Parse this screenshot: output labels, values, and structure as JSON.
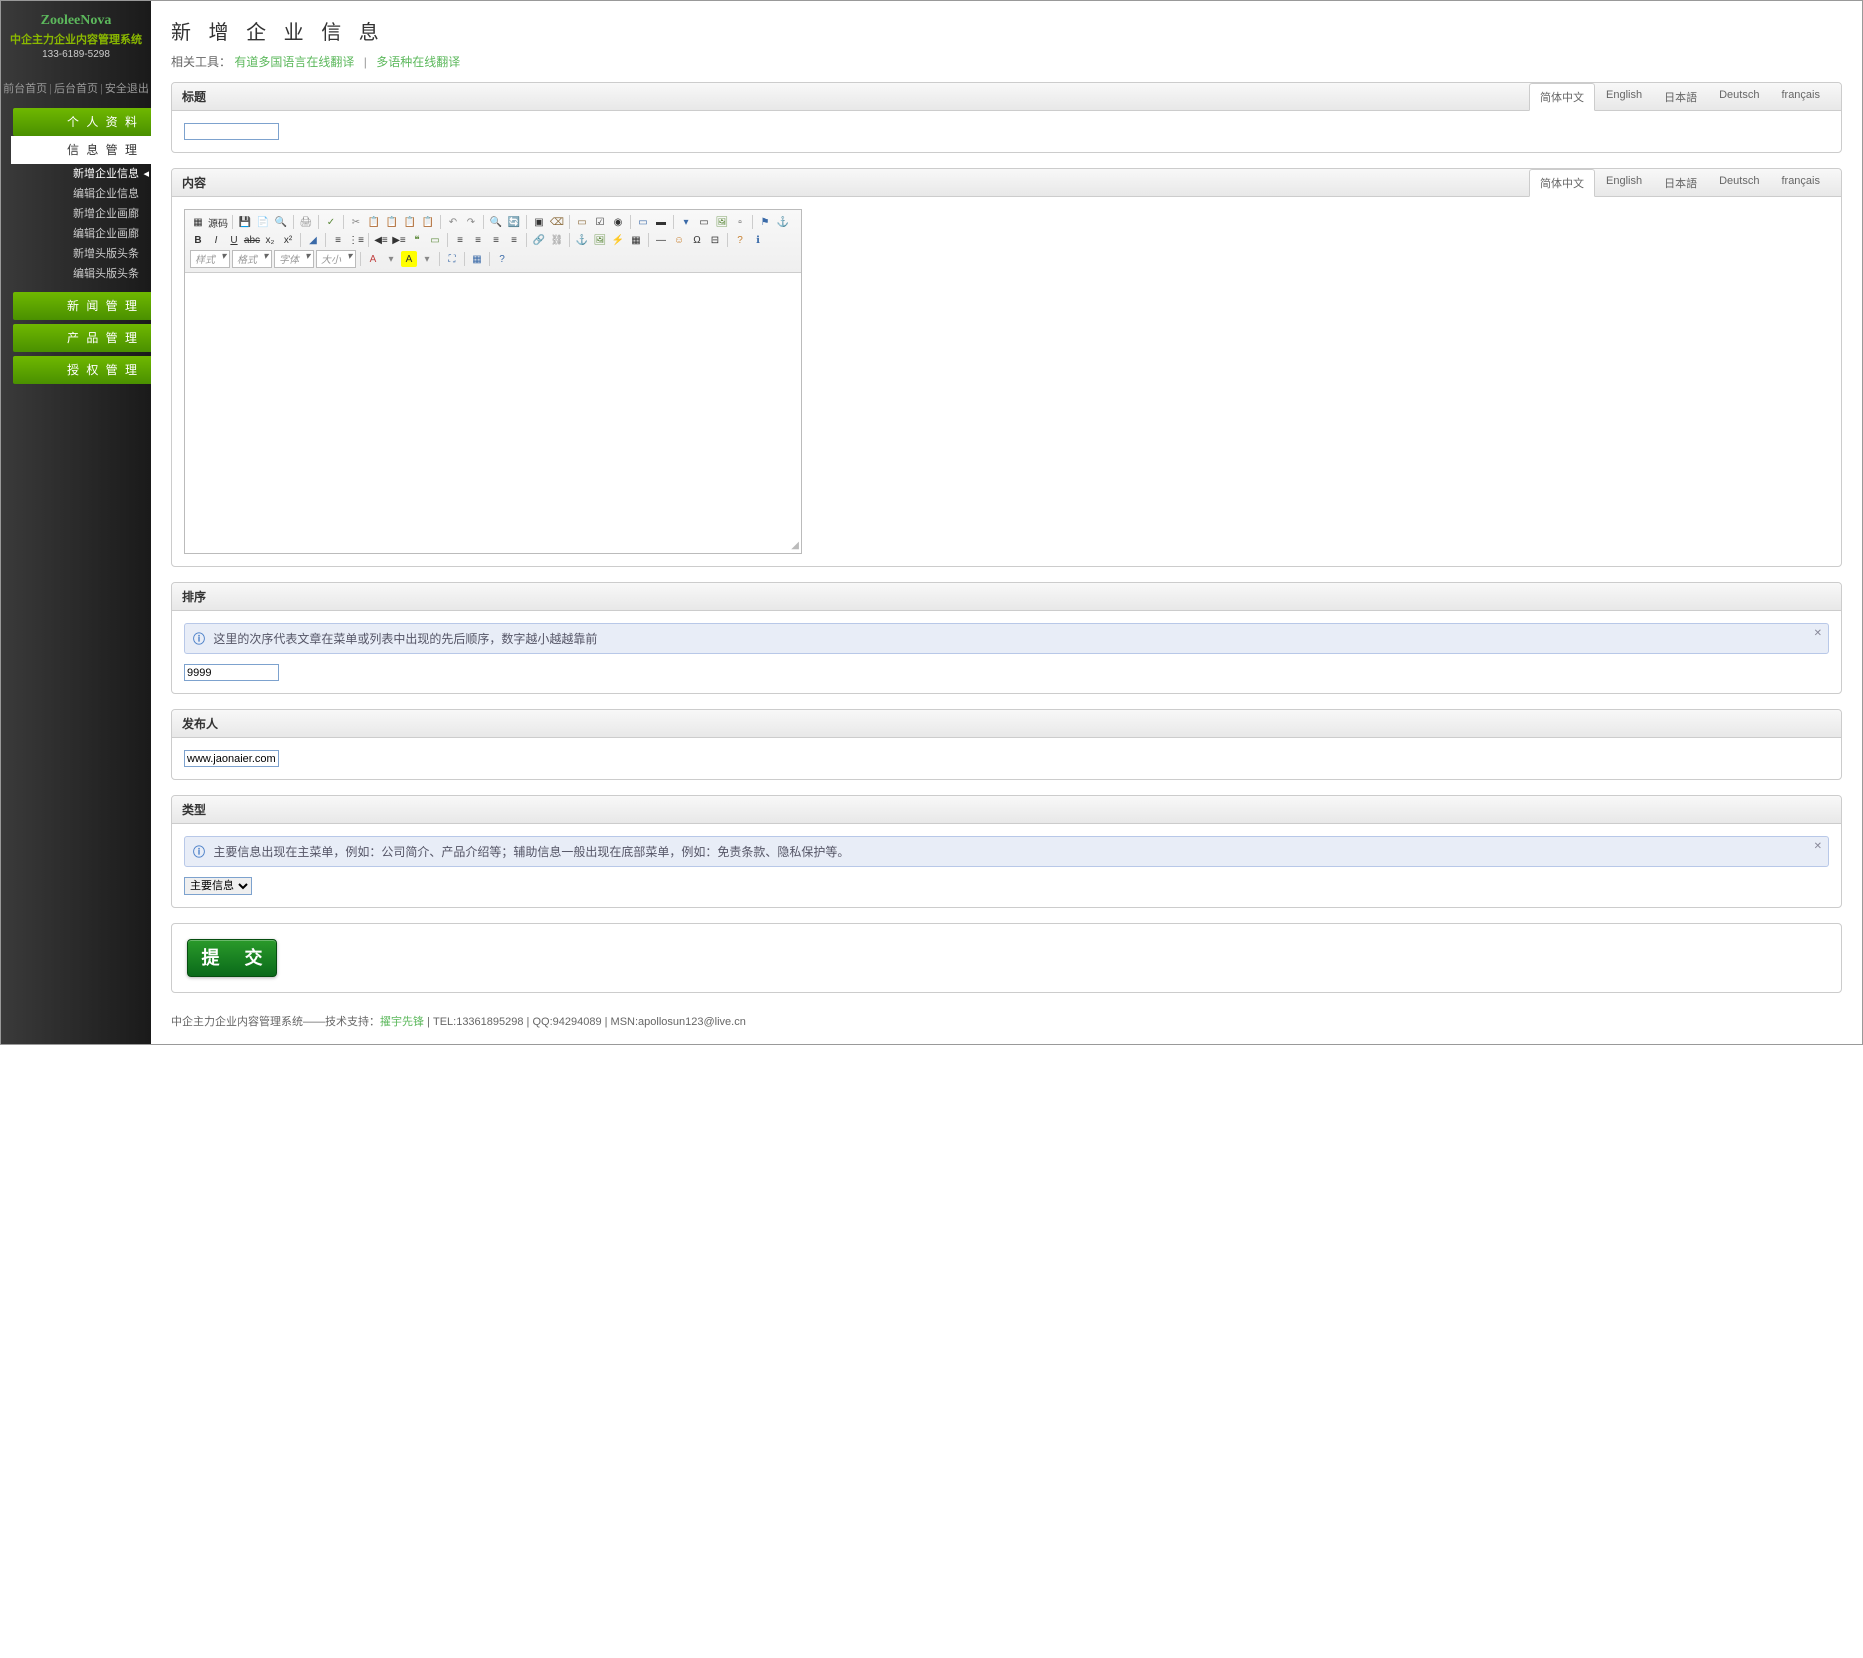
{
  "sidebar": {
    "logo1": "ZooleeNova",
    "logo2": "中企主力企业内容管理系统",
    "logo3": "133-6189-5298",
    "toplinks": [
      "前台首页",
      "后台首页",
      "安全退出"
    ],
    "nav": [
      {
        "label": "个 人 资 料",
        "type": "green"
      },
      {
        "label": "信 息 管 理",
        "type": "white"
      },
      {
        "label": "新增企业信息",
        "type": "sub",
        "active": true
      },
      {
        "label": "编辑企业信息",
        "type": "sub"
      },
      {
        "label": "新增企业画廊",
        "type": "sub"
      },
      {
        "label": "编辑企业画廊",
        "type": "sub"
      },
      {
        "label": "新增头版头条",
        "type": "sub"
      },
      {
        "label": "编辑头版头条",
        "type": "sub"
      },
      {
        "label": "新 闻 管 理",
        "type": "green"
      },
      {
        "label": "产 品 管 理",
        "type": "green"
      },
      {
        "label": "授 权 管 理",
        "type": "green"
      }
    ]
  },
  "page": {
    "title": "新 增 企 业 信 息",
    "toolsLabel": "相关工具：",
    "toolLinks": [
      "有道多国语言在线翻译",
      "多语种在线翻译"
    ]
  },
  "panels": {
    "title": {
      "label": "标题",
      "value": ""
    },
    "content": {
      "label": "内容"
    },
    "sort": {
      "label": "排序",
      "hint": "这里的次序代表文章在菜单或列表中出现的先后顺序，数字越小越越靠前",
      "value": "9999"
    },
    "publisher": {
      "label": "发布人",
      "value": "www.jaonaier.com"
    },
    "type": {
      "label": "类型",
      "hint": "主要信息出现在主菜单，例如：公司简介、产品介绍等；辅助信息一般出现在底部菜单，例如：免责条款、隐私保护等。",
      "selected": "主要信息"
    }
  },
  "langTabs": [
    "简体中文",
    "English",
    "日本語",
    "Deutsch",
    "français"
  ],
  "editor": {
    "sourceLabel": "源码",
    "combos": [
      "样式",
      "格式",
      "字体",
      "大小"
    ],
    "restore": "▫"
  },
  "submit": {
    "label": "提 交"
  },
  "footer": {
    "text1": "中企主力企业内容管理系统——技术支持：",
    "link1": "擢宇先锋",
    "text2": "  |  TEL:13361895298  |  QQ:94294089  |  MSN:apollosun123@live.cn"
  }
}
